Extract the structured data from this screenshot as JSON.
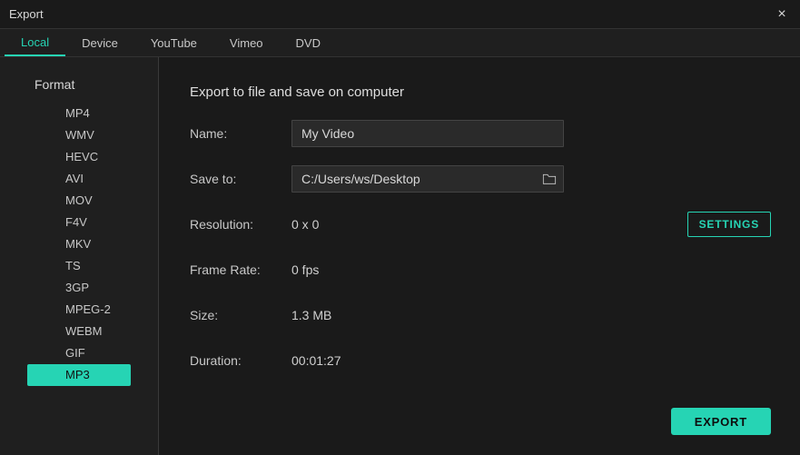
{
  "window": {
    "title": "Export"
  },
  "tabs": [
    {
      "label": "Local",
      "active": true
    },
    {
      "label": "Device",
      "active": false
    },
    {
      "label": "YouTube",
      "active": false
    },
    {
      "label": "Vimeo",
      "active": false
    },
    {
      "label": "DVD",
      "active": false
    }
  ],
  "sidebar": {
    "heading": "Format",
    "formats": [
      {
        "label": "MP4",
        "selected": false
      },
      {
        "label": "WMV",
        "selected": false
      },
      {
        "label": "HEVC",
        "selected": false
      },
      {
        "label": "AVI",
        "selected": false
      },
      {
        "label": "MOV",
        "selected": false
      },
      {
        "label": "F4V",
        "selected": false
      },
      {
        "label": "MKV",
        "selected": false
      },
      {
        "label": "TS",
        "selected": false
      },
      {
        "label": "3GP",
        "selected": false
      },
      {
        "label": "MPEG-2",
        "selected": false
      },
      {
        "label": "WEBM",
        "selected": false
      },
      {
        "label": "GIF",
        "selected": false
      },
      {
        "label": "MP3",
        "selected": true
      }
    ]
  },
  "main": {
    "heading": "Export to file and save on computer",
    "labels": {
      "name": "Name:",
      "save_to": "Save to:",
      "resolution": "Resolution:",
      "frame_rate": "Frame Rate:",
      "size": "Size:",
      "duration": "Duration:"
    },
    "name_value": "My Video",
    "save_to_value": "C:/Users/ws/Desktop",
    "resolution_value": "0 x 0",
    "frame_rate_value": "0 fps",
    "size_value": "1.3 MB",
    "duration_value": "00:01:27",
    "settings_button": "SETTINGS",
    "export_button": "EXPORT"
  }
}
